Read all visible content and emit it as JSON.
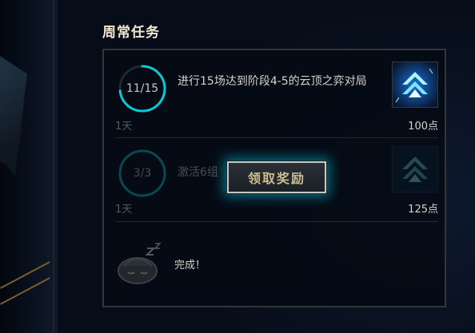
{
  "section_title": "周常任务",
  "missions": [
    {
      "progress_text": "11/15",
      "progress": 0.7333,
      "description": "进行15场达到阶段4-5的云顶之弈对局",
      "time_left": "1天",
      "reward_points": "100点",
      "reward_icon": "chevron-up-icon"
    },
    {
      "progress_text": "3/3",
      "progress": 1.0,
      "description": "激活6组",
      "time_left": "1天",
      "reward_points": "125点",
      "reward_icon": "chevron-up-icon"
    }
  ],
  "claim_button_label": "领取奖励",
  "completed_text": "完成！",
  "colors": {
    "ring_track": "#1c2a36",
    "ring_fill": "#0ac8d2",
    "gold": "#cdbe91",
    "glow": "#0ac8e6"
  }
}
